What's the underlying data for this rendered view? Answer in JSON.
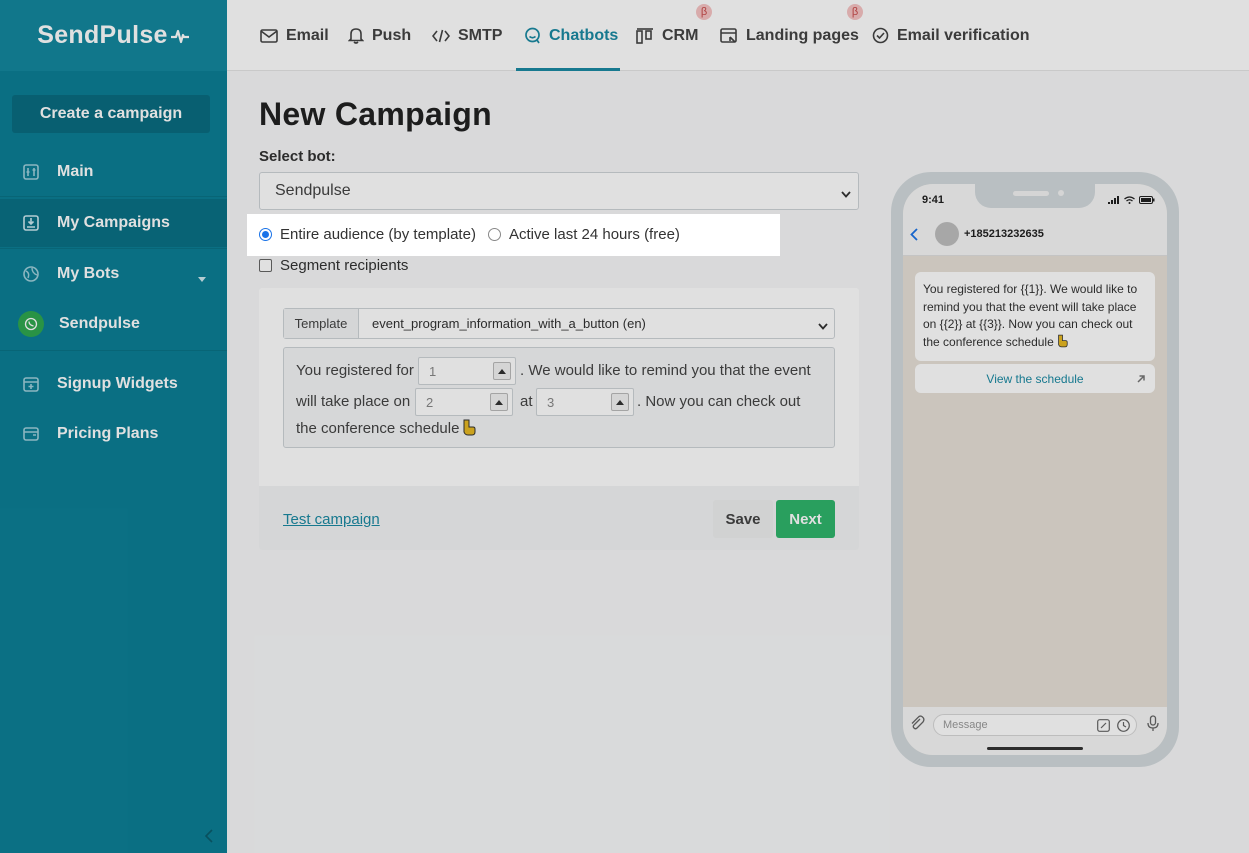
{
  "brand": {
    "name": "SendPulse"
  },
  "sidebar": {
    "create_label": "Create a campaign",
    "items": [
      {
        "label": "Main",
        "icon": "main-icon"
      },
      {
        "label": "My Campaigns",
        "icon": "campaigns-icon"
      },
      {
        "label": "My Bots",
        "icon": "bots-icon"
      },
      {
        "label": "Sendpulse",
        "icon": "whatsapp-icon"
      },
      {
        "label": "Signup Widgets",
        "icon": "widgets-icon"
      },
      {
        "label": "Pricing Plans",
        "icon": "pricing-icon"
      }
    ]
  },
  "topnav": {
    "tabs": [
      {
        "label": "Email"
      },
      {
        "label": "Push"
      },
      {
        "label": "SMTP"
      },
      {
        "label": "Chatbots"
      },
      {
        "label": "CRM"
      },
      {
        "label": "Landing pages"
      },
      {
        "label": "Email verification"
      }
    ],
    "beta_badge": "β"
  },
  "page": {
    "title": "New Campaign",
    "select_bot_label": "Select bot:",
    "selected_bot": "Sendpulse",
    "audience": {
      "option1": "Entire audience (by template)",
      "option2": "Active last 24 hours (free)",
      "selected": "option1"
    },
    "segment_label": "Segment recipients",
    "template_tag": "Template",
    "template_value": "event_program_information_with_a_button (en)",
    "template_text": {
      "part1": "You registered for",
      "part2": ". We would like to remind you that the event",
      "part3": "will take place on",
      "part4": "at",
      "part5": ". Now you can check out",
      "part6": "the conference schedule"
    },
    "params": [
      "1",
      "2",
      "3"
    ],
    "test_link": "Test campaign",
    "save_label": "Save",
    "next_label": "Next"
  },
  "phone": {
    "time": "9:41",
    "contact": "+185213232635",
    "message": "You registered for {{1}}. We would like to remind you that the event will take place on {{2}} at {{3}}. Now you can check out the conference schedule",
    "button": "View the schedule",
    "input_placeholder": "Message"
  },
  "colors": {
    "sidebar": "#0c7f96",
    "accent": "#1b8aa3",
    "next_button": "#2fb56b"
  }
}
